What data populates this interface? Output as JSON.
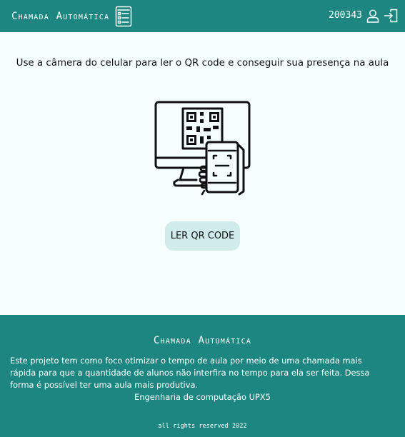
{
  "header": {
    "title": "Chamada Automática",
    "title_icon": "checklist-document-icon",
    "user_id": "200343",
    "user_icon": "user-icon",
    "logout_icon": "logout-icon"
  },
  "main": {
    "instruction": "Use a câmera do celular para ler o QR code e conseguir sua presença na aula",
    "illustration_icon": "qr-code-scan-icon",
    "read_button_label": "LER QR CODE"
  },
  "footer": {
    "title": "Chamada Automática",
    "description": "Este projeto tem como foco otimizar o tempo de aula por meio de uma chamada mais rápida para que a quantidade de alunos não interfira no tempo para ela ser feita. Dessa forma é possível ter uma aula mais produtiva.",
    "course": "Engenharia de computação UPX5",
    "rights": "all rights reserved 2022"
  },
  "colors": {
    "primary": "#1e8681",
    "background": "#f4fffe",
    "button": "#cfeceb",
    "text": "#111111"
  }
}
